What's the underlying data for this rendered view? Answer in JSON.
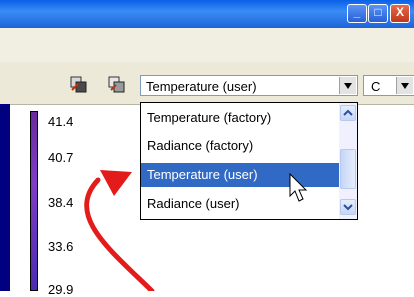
{
  "window": {
    "title": "",
    "buttons": {
      "minimize_glyph": "_",
      "maximize_glyph": "□",
      "close_glyph": "X"
    }
  },
  "toolbar": {
    "icons": [
      "export-icon",
      "copy-icon"
    ],
    "quantity_select": {
      "value": "Temperature (user)"
    },
    "unit_select": {
      "value": "C"
    }
  },
  "dropdown": {
    "options": [
      "Temperature (factory)",
      "Radiance (factory)",
      "Temperature (user)",
      "Radiance (user)"
    ],
    "selected_index": 2
  },
  "scale": {
    "ticks": [
      "41.4",
      "40.7",
      "38.4",
      "33.6",
      "29.9"
    ]
  },
  "colors": {
    "accent_selection": "#316ac5",
    "annotation_arrow": "#e31b1b",
    "titlebar": "#0a5fe8"
  }
}
